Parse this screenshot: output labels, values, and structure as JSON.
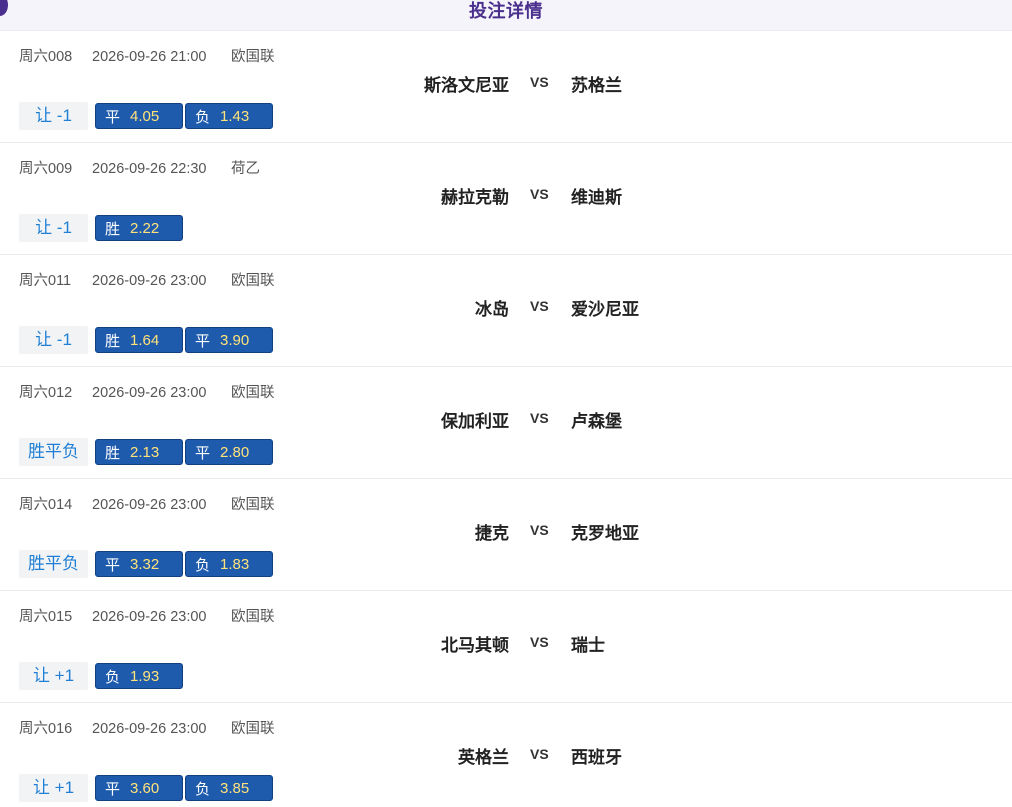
{
  "header": {
    "title": "投注详情"
  },
  "matches": [
    {
      "code": "周六008",
      "time": "2026-09-26 21:00",
      "league": "欧国联",
      "home": "斯洛文尼亚",
      "vs": "VS",
      "away": "苏格兰",
      "bet_type": "让 -1",
      "odds": [
        {
          "label": "平",
          "value": "4.05"
        },
        {
          "label": "负",
          "value": "1.43"
        }
      ]
    },
    {
      "code": "周六009",
      "time": "2026-09-26 22:30",
      "league": "荷乙",
      "home": "赫拉克勒",
      "vs": "VS",
      "away": "维迪斯",
      "bet_type": "让 -1",
      "odds": [
        {
          "label": "胜",
          "value": "2.22"
        }
      ]
    },
    {
      "code": "周六011",
      "time": "2026-09-26 23:00",
      "league": "欧国联",
      "home": "冰岛",
      "vs": "VS",
      "away": "爱沙尼亚",
      "bet_type": "让 -1",
      "odds": [
        {
          "label": "胜",
          "value": "1.64"
        },
        {
          "label": "平",
          "value": "3.90"
        }
      ]
    },
    {
      "code": "周六012",
      "time": "2026-09-26 23:00",
      "league": "欧国联",
      "home": "保加利亚",
      "vs": "VS",
      "away": "卢森堡",
      "bet_type": "胜平负",
      "odds": [
        {
          "label": "胜",
          "value": "2.13"
        },
        {
          "label": "平",
          "value": "2.80"
        }
      ]
    },
    {
      "code": "周六014",
      "time": "2026-09-26 23:00",
      "league": "欧国联",
      "home": "捷克",
      "vs": "VS",
      "away": "克罗地亚",
      "bet_type": "胜平负",
      "odds": [
        {
          "label": "平",
          "value": "3.32"
        },
        {
          "label": "负",
          "value": "1.83"
        }
      ]
    },
    {
      "code": "周六015",
      "time": "2026-09-26 23:00",
      "league": "欧国联",
      "home": "北马其顿",
      "vs": "VS",
      "away": "瑞士",
      "bet_type": "让 +1",
      "odds": [
        {
          "label": "负",
          "value": "1.93"
        }
      ]
    },
    {
      "code": "周六016",
      "time": "2026-09-26 23:00",
      "league": "欧国联",
      "home": "英格兰",
      "vs": "VS",
      "away": "西班牙",
      "bet_type": "让 +1",
      "odds": [
        {
          "label": "平",
          "value": "3.60"
        },
        {
          "label": "负",
          "value": "3.85"
        }
      ]
    }
  ]
}
